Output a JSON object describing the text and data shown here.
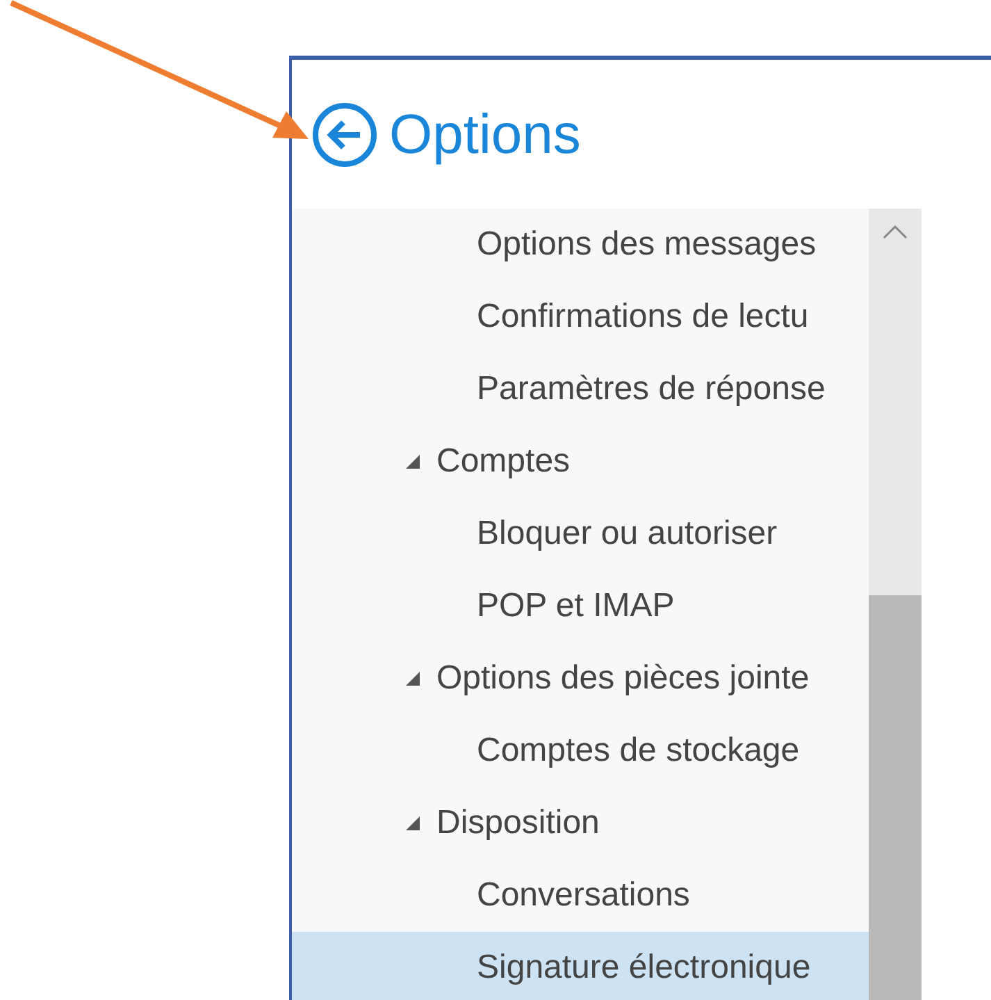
{
  "panel": {
    "title": "Options"
  },
  "nav": {
    "items": [
      {
        "children": [
          {
            "label": "Options des messages",
            "selected": false
          },
          {
            "label": "Confirmations de lectu",
            "selected": false
          },
          {
            "label": "Paramètres de réponse",
            "selected": false
          }
        ]
      },
      {
        "label": "Comptes",
        "expanded": true,
        "selected": false,
        "children": [
          {
            "label": "Bloquer ou autoriser",
            "selected": false
          },
          {
            "label": "POP et IMAP",
            "selected": false
          }
        ]
      },
      {
        "label": "Options des pièces jointe",
        "expanded": true,
        "selected": false,
        "children": [
          {
            "label": "Comptes de stockage",
            "selected": false
          }
        ]
      },
      {
        "label": "Disposition",
        "expanded": true,
        "selected": false,
        "children": [
          {
            "label": "Conversations",
            "selected": false
          },
          {
            "label": "Signature électronique",
            "selected": true
          }
        ]
      }
    ]
  }
}
